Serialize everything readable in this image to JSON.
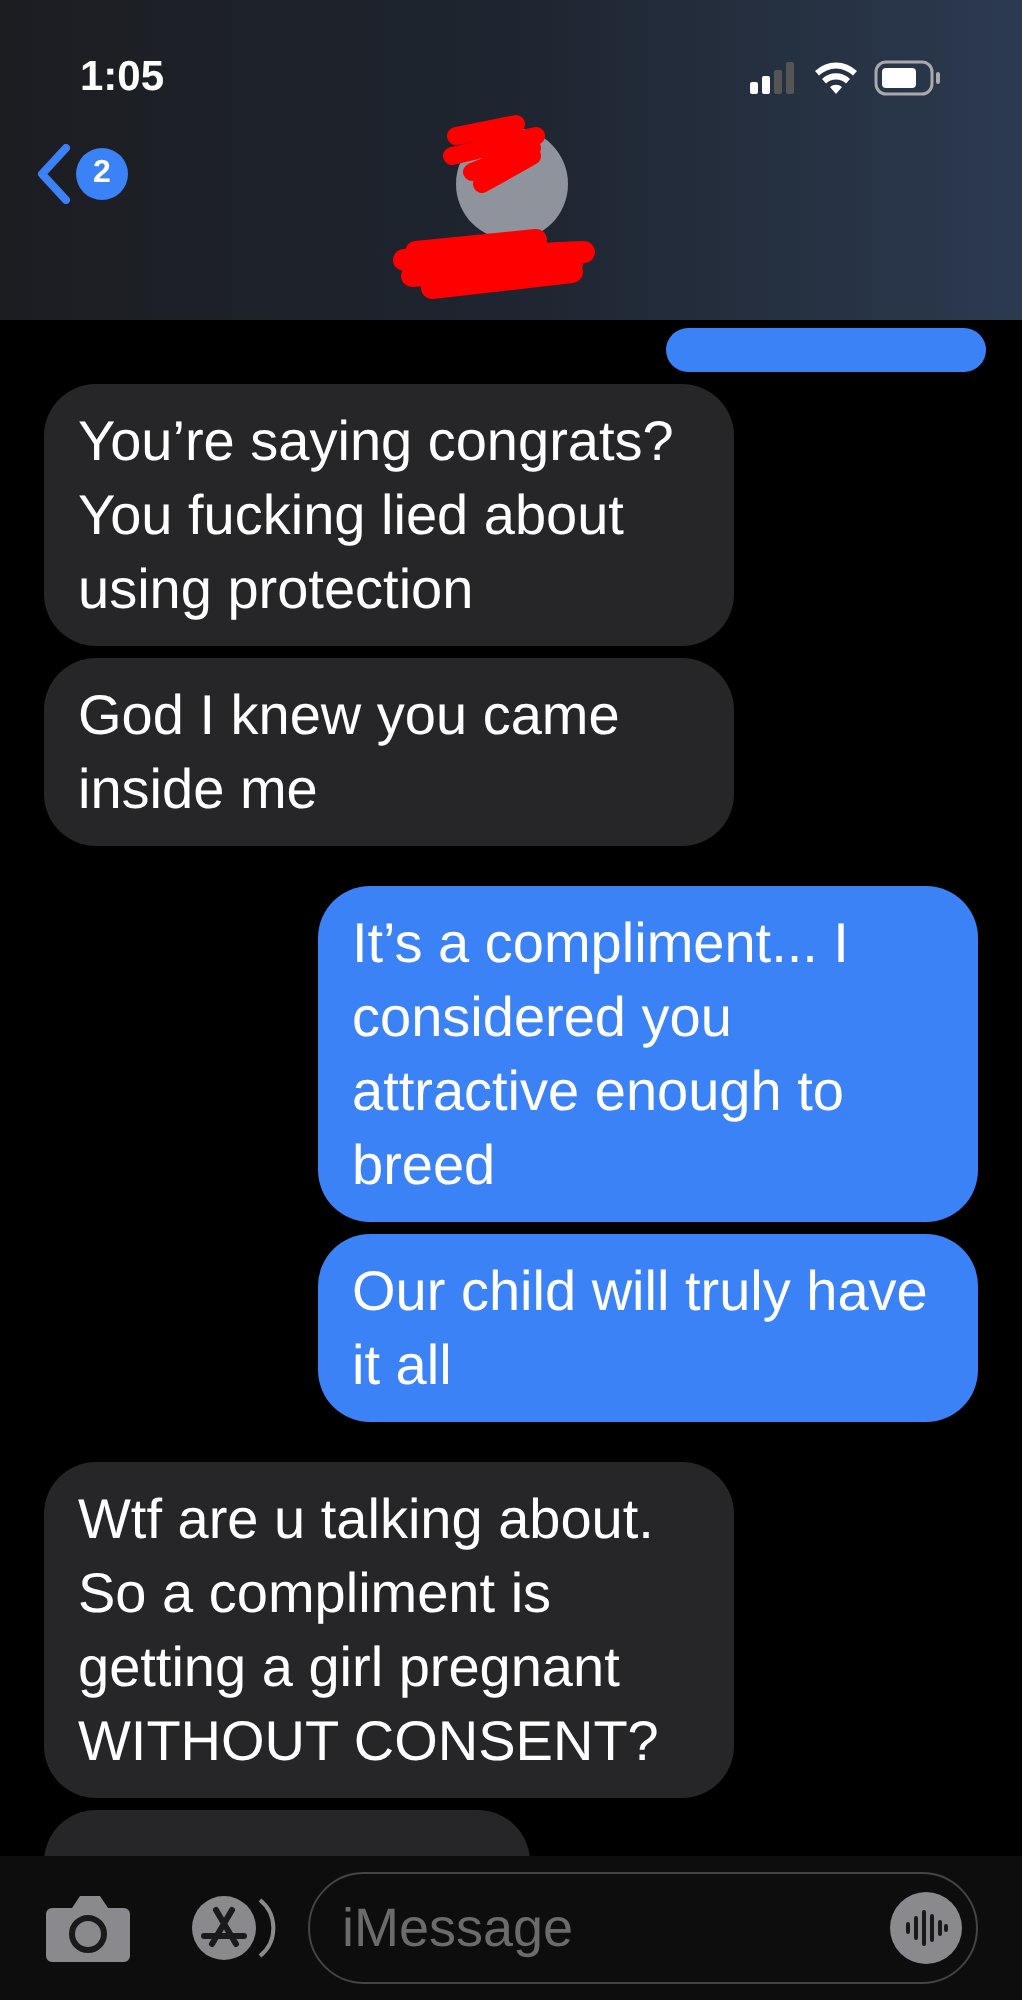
{
  "status_bar": {
    "time": "1:05"
  },
  "header": {
    "unread_count": "2"
  },
  "messages": [
    {
      "kind": "partial",
      "outgoing": true
    },
    {
      "kind": "text",
      "outgoing": false,
      "text": "You’re saying congrats? You fucking lied about using protection"
    },
    {
      "kind": "text",
      "outgoing": false,
      "text": "God I knew you came inside me"
    },
    {
      "kind": "text",
      "outgoing": true,
      "text": "It’s a compliment... I considered you attractive enough to breed"
    },
    {
      "kind": "text",
      "outgoing": true,
      "text": "Our child will truly have it all"
    },
    {
      "kind": "text",
      "outgoing": false,
      "text": "Wtf are u talking about. So a compliment is getting a girl pregnant WITHOUT CONSENT?"
    },
    {
      "kind": "partial",
      "outgoing": false
    }
  ],
  "composer": {
    "placeholder": "iMessage"
  }
}
